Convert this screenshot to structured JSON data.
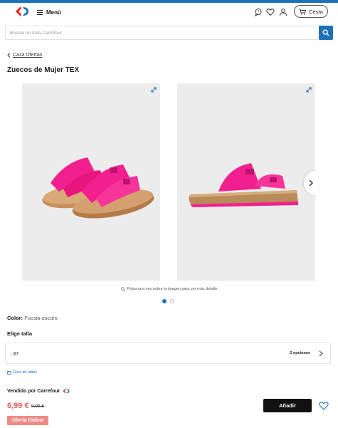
{
  "colors": {
    "accent": "#1d71b8",
    "sale": "#e85a5a",
    "badge": "#ef8a87",
    "pink": "#f2208f"
  },
  "header": {
    "logo_icon": "carrefour-logo",
    "menu_label": "Menú",
    "icons": [
      "chat-icon",
      "heart-icon",
      "user-icon"
    ],
    "cart_label": "Cesta"
  },
  "search": {
    "placeholder": "Buscar en todo Carrefour",
    "icon": "search-icon"
  },
  "breadcrumb": {
    "label": "Caza Ofertas"
  },
  "product": {
    "title": "Zuecos de Mujer TEX",
    "zoom_hint": "Pulsa una vez sobre la imagen para ver más detalle",
    "images_count": 2,
    "active_image": 1,
    "color_label": "Color:",
    "color_value": "Fucsia oscuro",
    "size_title": "Elige talla",
    "size_value": "37",
    "size_options": "2 opciones",
    "size_guide": "Guía de tallas",
    "seller_label": "Vendido por Carrefour",
    "price": "6,99 €",
    "old_price": "9,99 €",
    "badge": "Oferta Online",
    "add_label": "Añadir"
  }
}
